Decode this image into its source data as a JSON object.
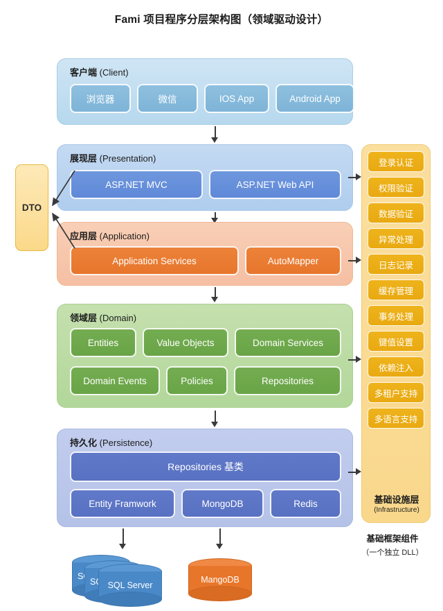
{
  "title": "Fami 项目程序分层架构图（领域驱动设计）",
  "layers": {
    "client": {
      "cn": "客户端",
      "en": "(Client)",
      "nodes": [
        "浏览器",
        "微信",
        "IOS App",
        "Android App"
      ]
    },
    "presentation": {
      "cn": "展现层",
      "en": "(Presentation)",
      "nodes": [
        "ASP.NET MVC",
        "ASP.NET Web API"
      ]
    },
    "application": {
      "cn": "应用层",
      "en": "(Application)",
      "nodes": [
        "Application Services",
        "AutoMapper"
      ]
    },
    "domain": {
      "cn": "领域层",
      "en": "(Domain)",
      "row1": [
        "Entities",
        "Value Objects",
        "Domain Services"
      ],
      "row2": [
        "Domain Events",
        "Policies",
        "Repositories"
      ]
    },
    "persistence": {
      "cn": "持久化",
      "en": "(Persistence)",
      "base": "Repositories 基类",
      "nodes": [
        "Entity Framwork",
        "MongoDB",
        "Redis"
      ]
    }
  },
  "dto": {
    "label": "DTO"
  },
  "infrastructure": {
    "items": [
      "登录认证",
      "权限验证",
      "数据验证",
      "异常处理",
      "日志记录",
      "缓存管理",
      "事务处理",
      "键值设置",
      "依赖注入",
      "多租户支持",
      "多语言支持"
    ],
    "label_cn": "基础设施层",
    "label_en": "(Infrastructure)"
  },
  "caption": {
    "cn": "基础框架组件",
    "en": "（一个独立 DLL）"
  },
  "databases": {
    "sqlserver": [
      "SQL Server",
      "SQ",
      "SQ"
    ],
    "mongodb": "MangoDB"
  },
  "colors": {
    "client": "#8fc0de",
    "presentation": "#6f97de",
    "application": "#ec8239",
    "domain": "#74ad51",
    "persistence": "#6079c8",
    "infrastructure": "#eeb31c",
    "dto": "#fbd98a",
    "sqlserver": "#4a89c8",
    "mongodb": "#e8762a"
  }
}
